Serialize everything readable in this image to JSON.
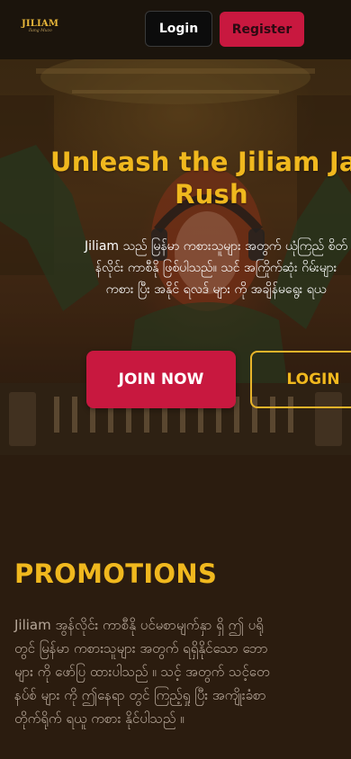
{
  "header": {
    "logo_text": "JILIAM",
    "logo_tagline": "Ilang Muzo",
    "login_label": "Login",
    "register_label": "Register"
  },
  "hero": {
    "title_line1": "Unleash the Jiliam Jac",
    "title_line2": "Rush",
    "description_lines": [
      "Jiliam သည် မြန်မာ ကစားသူများ အတွက် ယုံကြည် စိတ်",
      "န်လိုင်း ကာစီနို ဖြစ်ပါသည်။ သင် အကြိုက်ဆုံး ဂိမ်းများ",
      "ကစား ပြီး အနိုင် ရလဒ် များ ကို အချိန်မရွေး ရယ"
    ],
    "join_label": "JOIN NOW",
    "login_label": "LOGIN"
  },
  "promotions": {
    "title": "PROMOTIONS",
    "lines": [
      "Jiliam အွန်လိုင်း ကာစီနို ပင်မစာမျက်နှာ ရှိ ဤ ပရို",
      "တွင် မြန်မာ ကစားသူများ အတွက် ရရှိနိုင်သော ဘော",
      "များ ကို ဖော်ပြ ထားပါသည် ။ သင့် အတွက် သင့်တေ",
      "နပ်စ် များ ကို ဤနေရာ တွင် ကြည့်ရှု ပြီး အကျိုးခံစာ",
      "တိုက်ရိုက် ရယူ ကစား နိုင်ပါသည် ။"
    ]
  },
  "colors": {
    "accent_gold": "#f0b81e",
    "brand_red": "#c8183f",
    "header_bg": "#1b140c",
    "page_bg": "#2b1c0f"
  }
}
